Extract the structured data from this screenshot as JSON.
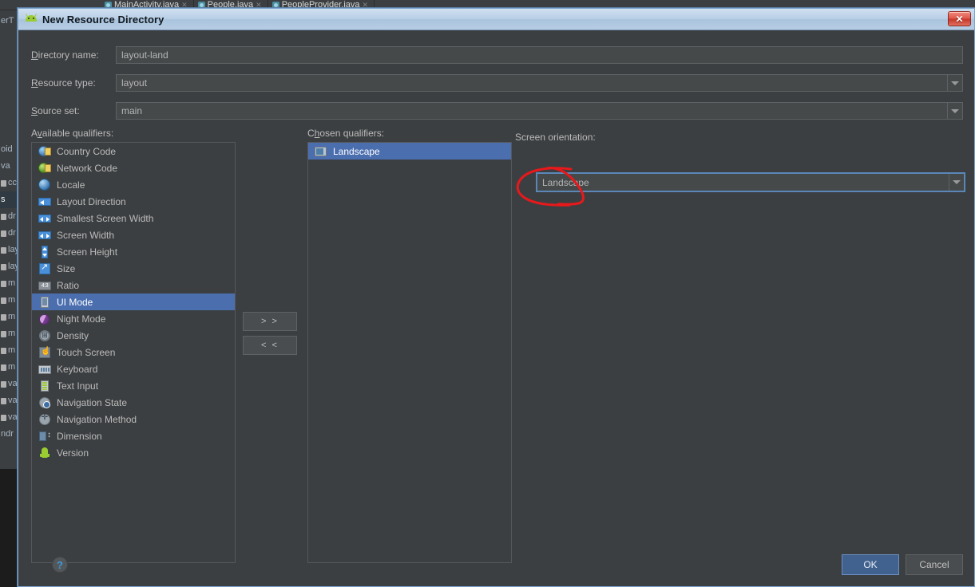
{
  "ide": {
    "tabs": [
      {
        "label": "MainActivity.java"
      },
      {
        "label": "People.java"
      },
      {
        "label": "PeopleProvider.java"
      }
    ],
    "tree": [
      {
        "label": "erT"
      },
      {
        "label": "oid"
      },
      {
        "label": "va"
      },
      {
        "label": "cc"
      },
      {
        "label": "s"
      },
      {
        "label": "dr"
      },
      {
        "label": "dr"
      },
      {
        "label": "lay"
      },
      {
        "label": "lay"
      },
      {
        "label": "m"
      },
      {
        "label": "m"
      },
      {
        "label": "m"
      },
      {
        "label": "m"
      },
      {
        "label": "m"
      },
      {
        "label": "m"
      },
      {
        "label": "va"
      },
      {
        "label": "va"
      },
      {
        "label": "va"
      },
      {
        "label": "ndr"
      }
    ]
  },
  "dialog": {
    "title": "New Resource Directory",
    "icon": "android-icon",
    "close_label": "✕",
    "fields": {
      "directory_name": {
        "label_pre": "D",
        "label_post": "irectory name:",
        "value": "layout-land"
      },
      "resource_type": {
        "label_pre": "R",
        "label_post": "esource type:",
        "value": "layout"
      },
      "source_set": {
        "label_pre": "S",
        "label_post": "ource set:",
        "value": "main"
      }
    },
    "available_label_pre": "A",
    "available_label_mn": "v",
    "available_label_post": "ailable qualifiers:",
    "chosen_label_pre": "C",
    "chosen_label_mn": "h",
    "chosen_label_post": "osen qualifiers:",
    "orientation_label": "Screen orientation:",
    "orientation_value": "Landscape",
    "available_qualifiers": [
      {
        "label": "Country Code",
        "icon": "globe-card-icon",
        "selected": false
      },
      {
        "label": "Network Code",
        "icon": "green-globe-card-icon",
        "selected": false
      },
      {
        "label": "Locale",
        "icon": "globe-icon",
        "selected": false
      },
      {
        "label": "Layout Direction",
        "icon": "arrow-left-icon",
        "selected": false
      },
      {
        "label": "Smallest Screen Width",
        "icon": "arrow-left-right-icon",
        "selected": false
      },
      {
        "label": "Screen Width",
        "icon": "arrow-horizontal-icon",
        "selected": false
      },
      {
        "label": "Screen Height",
        "icon": "arrow-vertical-icon",
        "selected": false
      },
      {
        "label": "Size",
        "icon": "diagonal-arrow-icon",
        "selected": false
      },
      {
        "label": "Ratio",
        "icon": "ratio-icon",
        "selected": false
      },
      {
        "label": "UI Mode",
        "icon": "ui-mode-icon",
        "selected": true
      },
      {
        "label": "Night Mode",
        "icon": "moon-icon",
        "selected": false
      },
      {
        "label": "Density",
        "icon": "density-icon",
        "selected": false
      },
      {
        "label": "Touch Screen",
        "icon": "touch-icon",
        "selected": false
      },
      {
        "label": "Keyboard",
        "icon": "keyboard-icon",
        "selected": false
      },
      {
        "label": "Text Input",
        "icon": "text-input-icon",
        "selected": false
      },
      {
        "label": "Navigation State",
        "icon": "navigation-state-icon",
        "selected": false
      },
      {
        "label": "Navigation Method",
        "icon": "navigation-method-icon",
        "selected": false
      },
      {
        "label": "Dimension",
        "icon": "dimension-icon",
        "selected": false
      },
      {
        "label": "Version",
        "icon": "android-version-icon",
        "selected": false
      }
    ],
    "chosen_qualifiers": [
      {
        "label": "Landscape",
        "icon": "landscape-icon",
        "selected": true
      }
    ],
    "add_button": "> >",
    "remove_button": "< <",
    "help_button": "?",
    "ok_button": "OK",
    "cancel_button": "Cancel",
    "ratio_icon_text": "4:3"
  },
  "annotation": {
    "shape": "red-ellipse",
    "color": "#e8181b",
    "target": "orientation-combo"
  }
}
